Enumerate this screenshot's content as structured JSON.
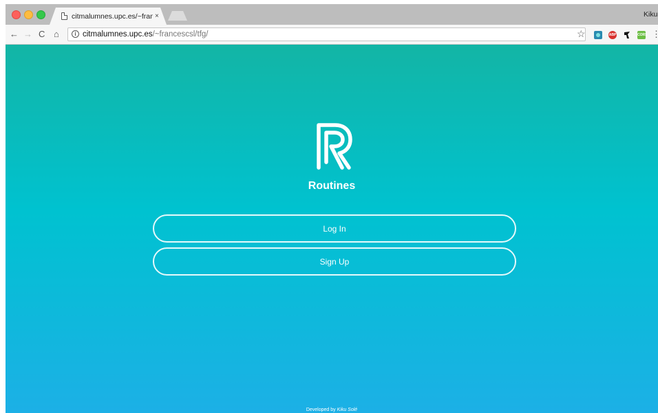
{
  "browser": {
    "tab_title": "citmalumnes.upc.es/~francesc",
    "tab_close": "×",
    "profile_name": "Kiku",
    "url_host": "citmalumnes.upc.es",
    "url_path": "/~francescsl/tfg/",
    "nav": {
      "back": "←",
      "forward": "→",
      "reload": "C",
      "home": "⌂"
    },
    "star": "☆",
    "menu": "⋮",
    "extensions": [
      "wave-extension-icon",
      "adblock-plus-icon",
      "runner-extension-icon",
      "cors-extension-icon"
    ],
    "ext_labels": {
      "abp": "ABP",
      "cors": "CORS"
    }
  },
  "page": {
    "app_title": "Routines",
    "login_label": "Log In",
    "signup_label": "Sign Up",
    "footer_prefix": "Developed by ",
    "footer_author": "Kiku Solé"
  },
  "colors": {
    "gradient_top": "#13b5a5",
    "gradient_mid": "#00c2d0",
    "gradient_bottom": "#1cb0e6",
    "foreground": "#ffffff"
  }
}
